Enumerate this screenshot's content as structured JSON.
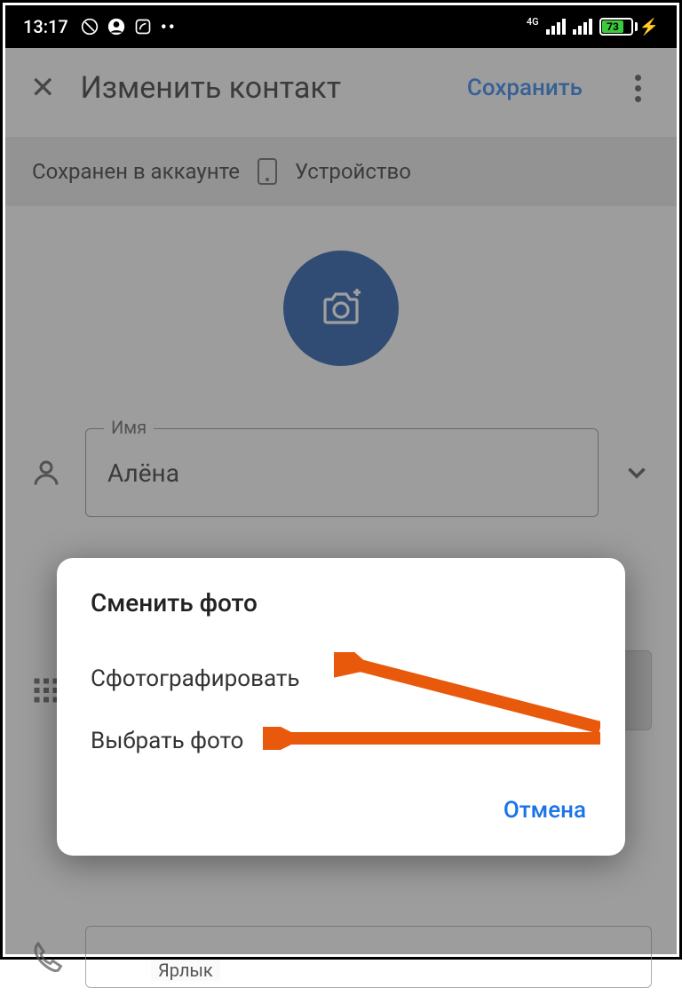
{
  "status": {
    "time": "13:17",
    "battery_pct": "73",
    "net_label": "4G"
  },
  "appbar": {
    "title": "Изменить контакт",
    "save_label": "Сохранить"
  },
  "account_bar": {
    "saved_in": "Сохранен в аккаунте",
    "location": "Устройство"
  },
  "fields": {
    "name_label": "Имя",
    "name_value": "Алёна",
    "yarlyk_label": "Ярлык"
  },
  "dialog": {
    "title": "Сменить фото",
    "item_take": "Сфотографировать",
    "item_pick": "Выбрать фото",
    "cancel": "Отмена"
  }
}
